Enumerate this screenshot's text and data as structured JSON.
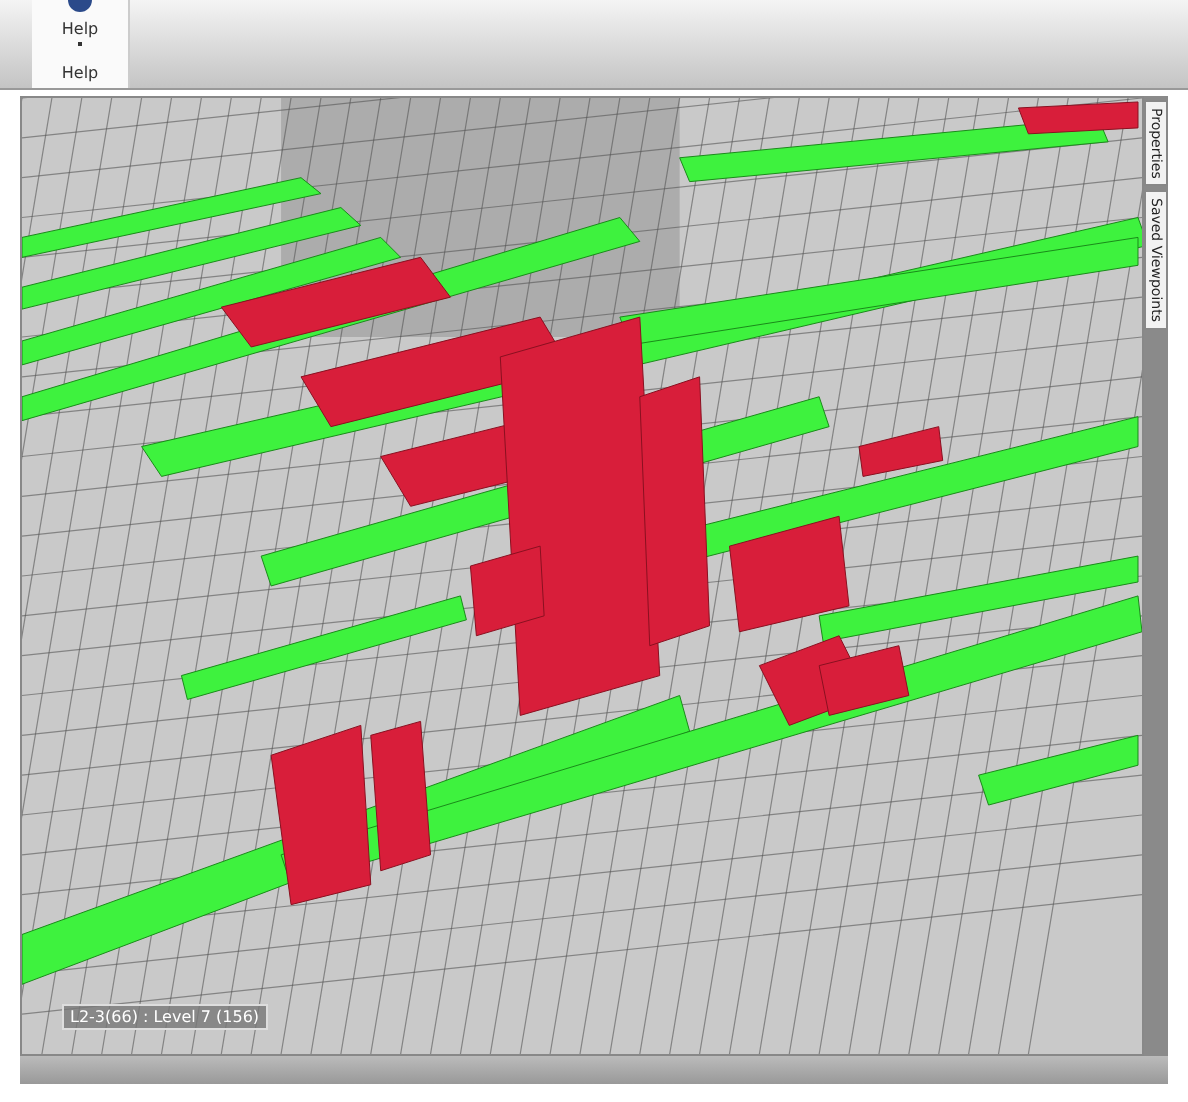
{
  "ribbon": {
    "button": "Help",
    "group_label": "Help"
  },
  "side_tabs": [
    {
      "label": "Properties"
    },
    {
      "label": "Saved Viewpoints"
    }
  ],
  "viewport": {
    "location_label": "L2-3(66) : Level 7 (156)"
  }
}
